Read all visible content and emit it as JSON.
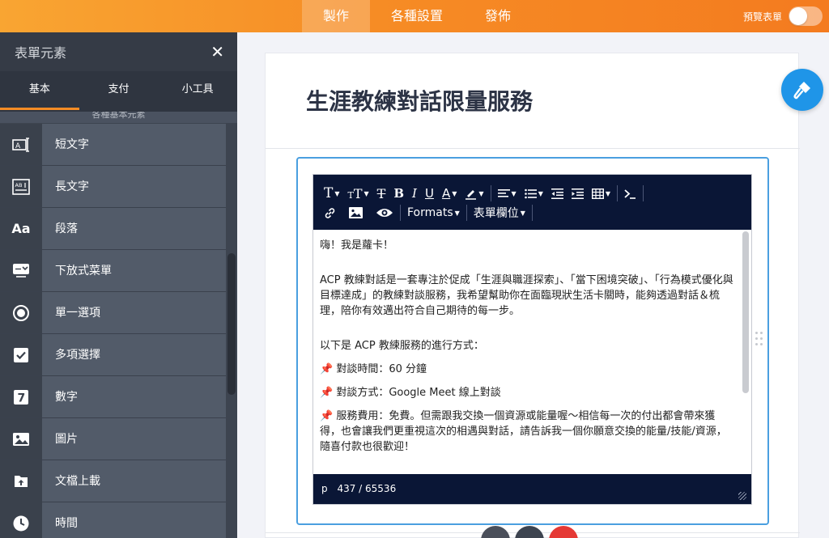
{
  "topbar": {
    "tabs": [
      {
        "label": "製作",
        "active": true
      },
      {
        "label": "各種設置",
        "active": false
      },
      {
        "label": "發佈",
        "active": false
      }
    ],
    "preview_label": "預覽表單"
  },
  "sidebar": {
    "title": "表單元素",
    "close_glyph": "✕",
    "tabs": [
      "基本",
      "支付",
      "小工具"
    ],
    "section_label": "各種基本元素",
    "items": [
      {
        "label": "短文字",
        "icon": "short-text-icon"
      },
      {
        "label": "長文字",
        "icon": "long-text-icon"
      },
      {
        "label": "段落",
        "icon": "paragraph-icon"
      },
      {
        "label": "下放式菜單",
        "icon": "dropdown-icon"
      },
      {
        "label": "單一選項",
        "icon": "radio-icon"
      },
      {
        "label": "多項選擇",
        "icon": "checkbox-icon"
      },
      {
        "label": "數字",
        "icon": "number-icon"
      },
      {
        "label": "圖片",
        "icon": "image-icon"
      },
      {
        "label": "文檔上載",
        "icon": "upload-icon"
      },
      {
        "label": "時間",
        "icon": "clock-icon"
      }
    ]
  },
  "card": {
    "title": "生涯教練對話限量服務"
  },
  "editor": {
    "toolbar": {
      "formats_label": "Formats",
      "form_fields_label": "表單欄位"
    },
    "content": {
      "line1": "嗨！我是蘿卡！",
      "para1": "ACP 教練對話是一套專注於促成「生涯與職涯探索」、「當下困境突破」、「行為模式優化與目標達成」的教練對談服務，我希望幫助你在面臨現狀生活卡關時，能夠透過對話＆梳理，陪你有效邁出符合自己期待的每一步。",
      "para2": "以下是 ACP 教練服務的進行方式：",
      "item1": "對談時間：60 分鐘",
      "item2": "對談方式：Google Meet 線上對談",
      "item3": "服務費用：免費。但需跟我交換一個資源或能量喔～相信每一次的付出都會帶來獲得，也會讓我們更重視這次的相遇與對話，請告訴我一個你願意交換的能量/技能/資源，隨喜付款也很歡迎！"
    },
    "status": {
      "tag": "p",
      "count": "437 / 65536"
    }
  },
  "colors": {
    "accent_orange": "#f68c25",
    "sidebar_bg": "#3d4450",
    "editor_bar": "#0a1636",
    "focus_blue": "#4a9fe0",
    "fab_blue": "#1f95e8"
  }
}
